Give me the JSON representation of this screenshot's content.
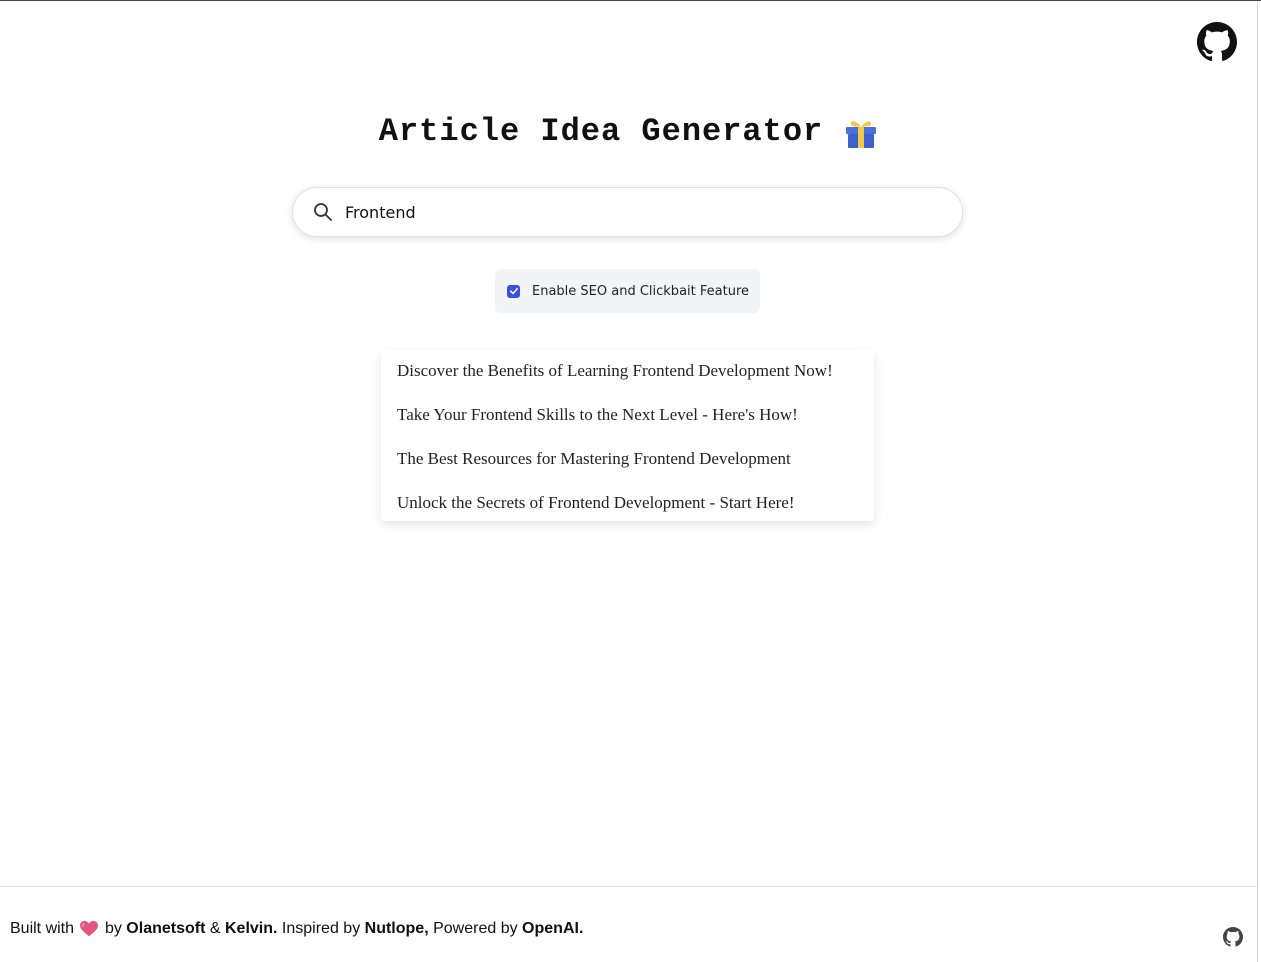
{
  "header": {
    "title": "Article Idea Generator",
    "title_icon": "gift-icon",
    "github_icon": "github-icon"
  },
  "search": {
    "value": "Frontend",
    "icon": "search-icon"
  },
  "seo": {
    "checked": true,
    "label": "Enable SEO and Clickbait Feature"
  },
  "results": [
    "Discover the Benefits of Learning Frontend Development Now!",
    "Take Your Frontend Skills to the Next Level - Here's How!",
    "The Best Resources for Mastering Frontend Development",
    "Unlock the Secrets of Frontend Development - Start Here!"
  ],
  "footer": {
    "built_with": "Built with",
    "heart_icon": "heart-icon",
    "by": "by",
    "author1": "Olanetsoft",
    "amp": "&",
    "author2": "Kelvin.",
    "inspired": "Inspired by",
    "inspiration": "Nutlope,",
    "powered": "Powered by",
    "powered_by": "OpenAI.",
    "github_icon": "github-icon"
  },
  "colors": {
    "accent": "#3b4fe0",
    "heart": "#e75480",
    "gift_box": "#4a6fd8",
    "gift_ribbon": "#f2c94c"
  }
}
